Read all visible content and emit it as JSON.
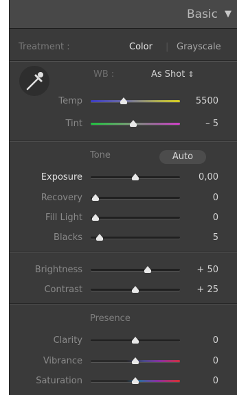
{
  "panel": {
    "title": "Basic",
    "collapse_icon": "triangle-down-icon"
  },
  "treatment": {
    "label": "Treatment :",
    "color": "Color",
    "divider": "|",
    "grayscale": "Grayscale"
  },
  "wb": {
    "label": "WB :",
    "value": "As Shot",
    "arrows": "⇕",
    "eyedropper_icon": "eyedropper-icon"
  },
  "tone": {
    "label": "Tone",
    "auto": "Auto"
  },
  "presence": {
    "label": "Presence"
  },
  "sliders": [
    {
      "label": "Temp",
      "value": "5500",
      "position": 0.37
    },
    {
      "label": "Tint",
      "value": "– 5",
      "position": 0.48
    },
    {
      "label": "Exposure",
      "value": "0,00",
      "position": 0.5
    },
    {
      "label": "Recovery",
      "value": "0",
      "position": 0.05
    },
    {
      "label": "Fill Light",
      "value": "0",
      "position": 0.05
    },
    {
      "label": "Blacks",
      "value": "5",
      "position": 0.1
    },
    {
      "label": "Brightness",
      "value": "+ 50",
      "position": 0.64
    },
    {
      "label": "Contrast",
      "value": "+ 25",
      "position": 0.5
    },
    {
      "label": "Clarity",
      "value": "0",
      "position": 0.5
    },
    {
      "label": "Vibrance",
      "value": "0",
      "position": 0.5
    },
    {
      "label": "Saturation",
      "value": "0",
      "position": 0.5
    }
  ]
}
